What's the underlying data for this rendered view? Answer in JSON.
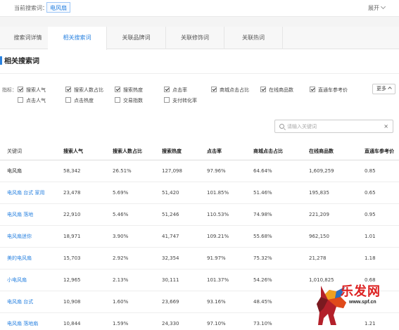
{
  "topbar": {
    "current_label": "当前搜索词：",
    "keyword": "电风扇",
    "expand_label": "展开"
  },
  "tabs": [
    "搜索词详情",
    "相关搜索词",
    "关联品牌词",
    "关联修饰词",
    "关联热词"
  ],
  "active_tab": 1,
  "section_title": "相关搜索词",
  "indicators": {
    "label": "指标：",
    "items": [
      {
        "label": "搜索人气",
        "checked": true
      },
      {
        "label": "搜索人数占比",
        "checked": true
      },
      {
        "label": "搜索热度",
        "checked": true
      },
      {
        "label": "点击率",
        "checked": true
      },
      {
        "label": "商城点击占比",
        "checked": true
      },
      {
        "label": "在线商品数",
        "checked": true
      },
      {
        "label": "直通车参考价",
        "checked": true
      },
      {
        "label": "点击人气",
        "checked": false
      },
      {
        "label": "点击热度",
        "checked": false
      },
      {
        "label": "交易指数",
        "checked": false
      },
      {
        "label": "支付转化率",
        "checked": false
      }
    ],
    "more_label": "更多"
  },
  "search": {
    "placeholder": "请输入关键词",
    "clear_icon": "×"
  },
  "table": {
    "headers": [
      "关键词",
      "搜索人气",
      "搜索人数占比",
      "搜索热度",
      "点击率",
      "商城点击占比",
      "在线商品数",
      "直通车参考价"
    ],
    "rows": [
      [
        "电风扇",
        "58,342",
        "26.51%",
        "127,098",
        "97.96%",
        "64.64%",
        "1,609,259",
        "0.85"
      ],
      [
        "电风扇 台式 家用",
        "23,478",
        "5.69%",
        "51,420",
        "101.85%",
        "51.46%",
        "195,835",
        "0.65"
      ],
      [
        "电风扇 落地",
        "22,910",
        "5.46%",
        "51,246",
        "110.53%",
        "74.98%",
        "221,209",
        "0.95"
      ],
      [
        "电风扇迷你",
        "18,971",
        "3.90%",
        "41,747",
        "109.21%",
        "55.68%",
        "962,150",
        "1.01"
      ],
      [
        "美的电风扇",
        "15,703",
        "2.92%",
        "32,354",
        "91.97%",
        "75.32%",
        "21,278",
        "1.18"
      ],
      [
        "小电风扇",
        "12,965",
        "2.13%",
        "30,111",
        "101.37%",
        "54.26%",
        "1,010,825",
        "0.68"
      ],
      [
        "电风扇 台式",
        "10,908",
        "1.60%",
        "23,669",
        "93.16%",
        "48.45%",
        "",
        ""
      ],
      [
        "电风扇 落地扇",
        "10,844",
        "1.59%",
        "24,330",
        "97.10%",
        "73.10%",
        "",
        "1.21"
      ]
    ]
  },
  "watermark": {
    "text": "乐发网",
    "url": "www.spf.cn"
  },
  "colors": {
    "accent": "#2b83e0",
    "watermark_red": "#dd2222"
  }
}
